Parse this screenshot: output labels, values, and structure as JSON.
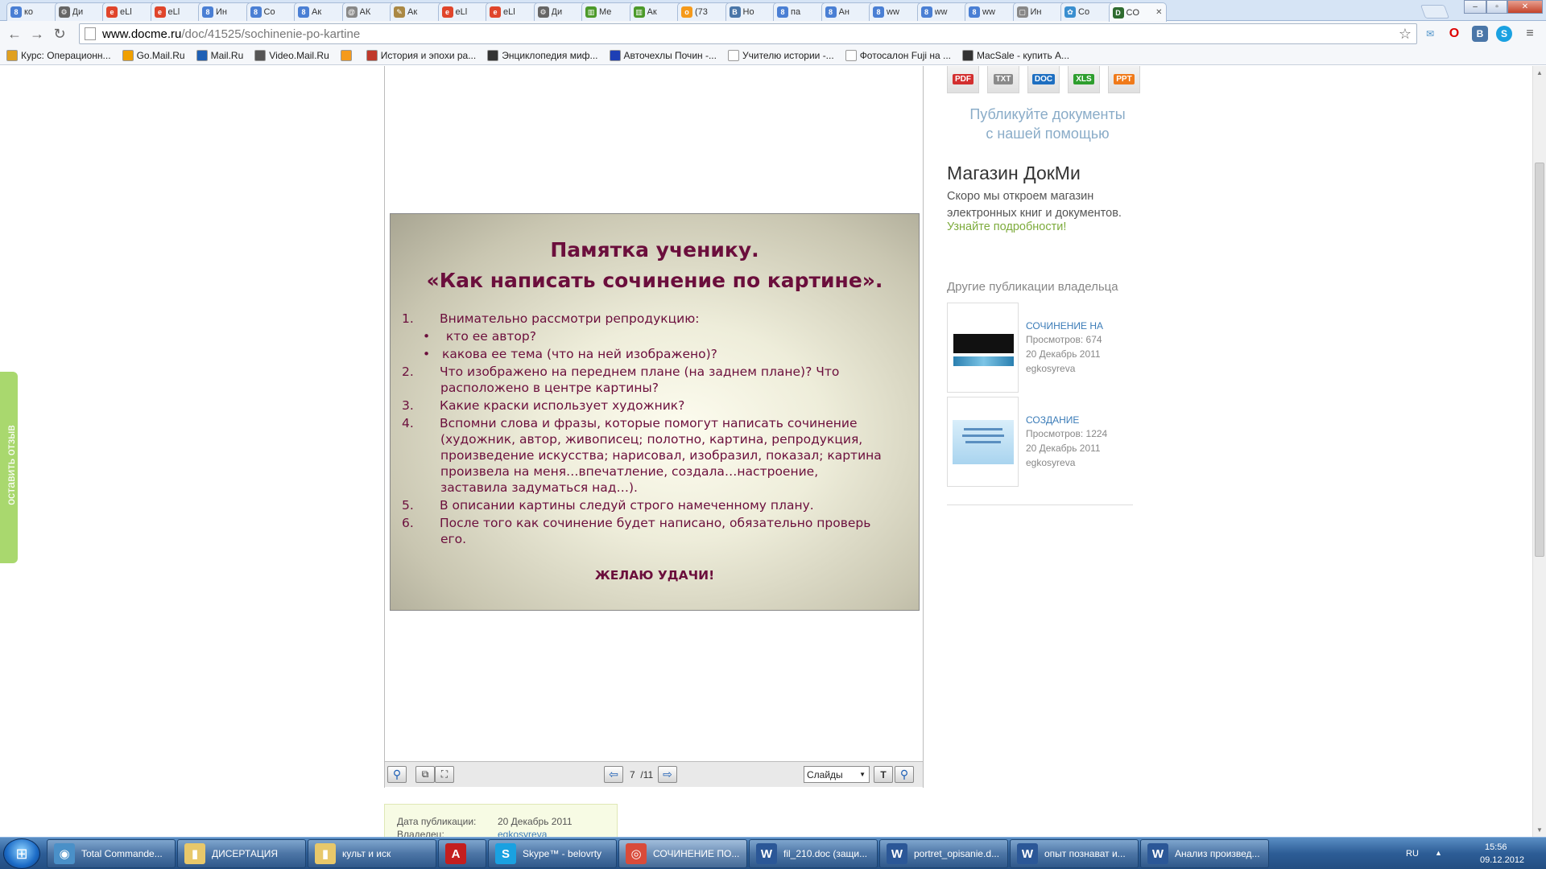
{
  "tabs": [
    {
      "label": "ко",
      "icon": "8",
      "color": "#4a7fd4"
    },
    {
      "label": "Ди",
      "icon": "⚙",
      "color": "#666666"
    },
    {
      "label": "eLl",
      "icon": "e",
      "color": "#e0452b"
    },
    {
      "label": "eLl",
      "icon": "e",
      "color": "#e0452b"
    },
    {
      "label": "Ин",
      "icon": "8",
      "color": "#4a7fd4"
    },
    {
      "label": "Co",
      "icon": "8",
      "color": "#4a7fd4"
    },
    {
      "label": "Ак",
      "icon": "8",
      "color": "#4a7fd4"
    },
    {
      "label": "АК",
      "icon": "@",
      "color": "#888888"
    },
    {
      "label": "Ак",
      "icon": "✎",
      "color": "#aa8844"
    },
    {
      "label": "eLl",
      "icon": "e",
      "color": "#e0452b"
    },
    {
      "label": "eLl",
      "icon": "e",
      "color": "#e0452b"
    },
    {
      "label": "Ди",
      "icon": "⚙",
      "color": "#666666"
    },
    {
      "label": "Ме",
      "icon": "▥",
      "color": "#4c9a2a"
    },
    {
      "label": "Ак",
      "icon": "▥",
      "color": "#4c9a2a"
    },
    {
      "label": "(73",
      "icon": "o",
      "color": "#f59a1b"
    },
    {
      "label": "Но",
      "icon": "B",
      "color": "#4a76a8"
    },
    {
      "label": "па",
      "icon": "8",
      "color": "#4a7fd4"
    },
    {
      "label": "Ан",
      "icon": "8",
      "color": "#4a7fd4"
    },
    {
      "label": "ww",
      "icon": "8",
      "color": "#4a7fd4"
    },
    {
      "label": "ww",
      "icon": "8",
      "color": "#4a7fd4"
    },
    {
      "label": "ww",
      "icon": "8",
      "color": "#4a7fd4"
    },
    {
      "label": "Ин",
      "icon": "▢",
      "color": "#888888"
    },
    {
      "label": "Co",
      "icon": "✿",
      "color": "#3a8fd0"
    },
    {
      "label": "CO",
      "icon": "D",
      "color": "#2f6b2f"
    }
  ],
  "address": {
    "domain": "www.docme.ru",
    "path": "/doc/41525/sochinenie-po-kartine"
  },
  "bookmarks": [
    {
      "label": "Курс: Операционн...",
      "color": "#e0a020"
    },
    {
      "label": "Go.Mail.Ru",
      "color": "#f0a000"
    },
    {
      "label": "Mail.Ru",
      "color": "#1d5fb5"
    },
    {
      "label": "Video.Mail.Ru",
      "color": "#555555"
    },
    {
      "label": "",
      "color": "#f59a1b"
    },
    {
      "label": "История и эпохи ра...",
      "color": "#c0392b"
    },
    {
      "label": "Энциклопедия миф...",
      "color": "#333333"
    },
    {
      "label": "Авточехлы Почин -...",
      "color": "#1d3fb5"
    },
    {
      "label": "Учителю истории -...",
      "color": "#ffffff"
    },
    {
      "label": "Фотосалон Fuji на ...",
      "color": "#ffffff"
    },
    {
      "label": "MacSale - купить А...",
      "color": "#333333"
    }
  ],
  "feedback": "оставить отзыв",
  "slide": {
    "title1": "Памятка ученику.",
    "title2": "«Как написать сочинение по картине».",
    "items": [
      {
        "num": "1.",
        "text": "Внимательно рассмотри репродукцию:",
        "kind": "num"
      },
      {
        "num": "",
        "text": " кто ее автор?",
        "kind": "bullet"
      },
      {
        "num": "",
        "text": "какова ее тема (что на ней изображено)?",
        "kind": "bullet"
      },
      {
        "num": "2.",
        "text": "Что изображено на переднем плане (на заднем плане)? Что расположено в центре картины?",
        "kind": "num"
      },
      {
        "num": "3.",
        "text": "Какие краски использует художник?",
        "kind": "num"
      },
      {
        "num": "4.",
        "text": "Вспомни слова и фразы, которые помогут написать сочинение (художник, автор, живописец; полотно, картина, репродукция, произведение искусства; нарисовал, изобразил, показал; картина произвела на меня…впечатление, создала…настроение, заставила задуматься над…).",
        "kind": "num"
      },
      {
        "num": "5.",
        "text": "В описании картины следуй строго намеченному плану.",
        "kind": "num"
      },
      {
        "num": "6.",
        "text": "После того как сочинение будет написано, обязательно проверь его.",
        "kind": "num"
      }
    ],
    "wish": "ЖЕЛАЮ УДАЧИ!"
  },
  "viewer": {
    "page": "7",
    "total": "/11",
    "mode": "Слайды"
  },
  "pubinfo": {
    "date_label": "Дата публикации:",
    "date": "20 Декабрь 2011",
    "owner_label": "Владелец:",
    "owner": "egkosyreva"
  },
  "formats": [
    {
      "label": "PDF",
      "color": "#d32f2f"
    },
    {
      "label": "TXT",
      "color": "#8a8a8a"
    },
    {
      "label": "DOC",
      "color": "#1e6fc1"
    },
    {
      "label": "XLS",
      "color": "#2e9e2e"
    },
    {
      "label": "PPT",
      "color": "#f07a1a"
    }
  ],
  "sidebar": {
    "publish1": "Публикуйте документы",
    "publish2": "с нашей помощью",
    "shop_title": "Магазин ДокМи",
    "shop_text": "Скоро мы откроем магазин электронных книг и документов.",
    "shop_link": "Узнайте подробности!",
    "other_title": "Другие публикации владельца",
    "pubs": [
      {
        "title": "СОЧИНЕНИЕ НА",
        "views": "Просмотров: 674",
        "date": "20 Декабрь 2011",
        "owner": "egkosyreva"
      },
      {
        "title": "СОЗДАНИЕ",
        "views": "Просмотров: 1224",
        "date": "20 Декабрь 2011",
        "owner": "egkosyreva"
      }
    ]
  },
  "taskbar": [
    {
      "label": "Total Commande...",
      "icon": "◉",
      "color": "#4a90c8"
    },
    {
      "label": "ДИСЕРТАЦИЯ",
      "icon": "▮",
      "color": "#e8c86a"
    },
    {
      "label": "культ и иск",
      "icon": "▮",
      "color": "#e8c86a"
    },
    {
      "label": "",
      "icon": "A",
      "color": "#c41e1e"
    },
    {
      "label": "Skype™ - belovrty",
      "icon": "S",
      "color": "#1aa1e1"
    },
    {
      "label": "СОЧИНЕНИЕ ПО...",
      "icon": "◎",
      "color": "#d94b3a"
    },
    {
      "label": "fil_210.doc (защи...",
      "icon": "W",
      "color": "#2b5797"
    },
    {
      "label": "portret_opisanie.d...",
      "icon": "W",
      "color": "#2b5797"
    },
    {
      "label": "опыт познават и...",
      "icon": "W",
      "color": "#2b5797"
    },
    {
      "label": "Анализ произвед...",
      "icon": "W",
      "color": "#2b5797"
    }
  ],
  "tray": {
    "lang": "RU",
    "time": "15:56",
    "date": "09.12.2012"
  }
}
